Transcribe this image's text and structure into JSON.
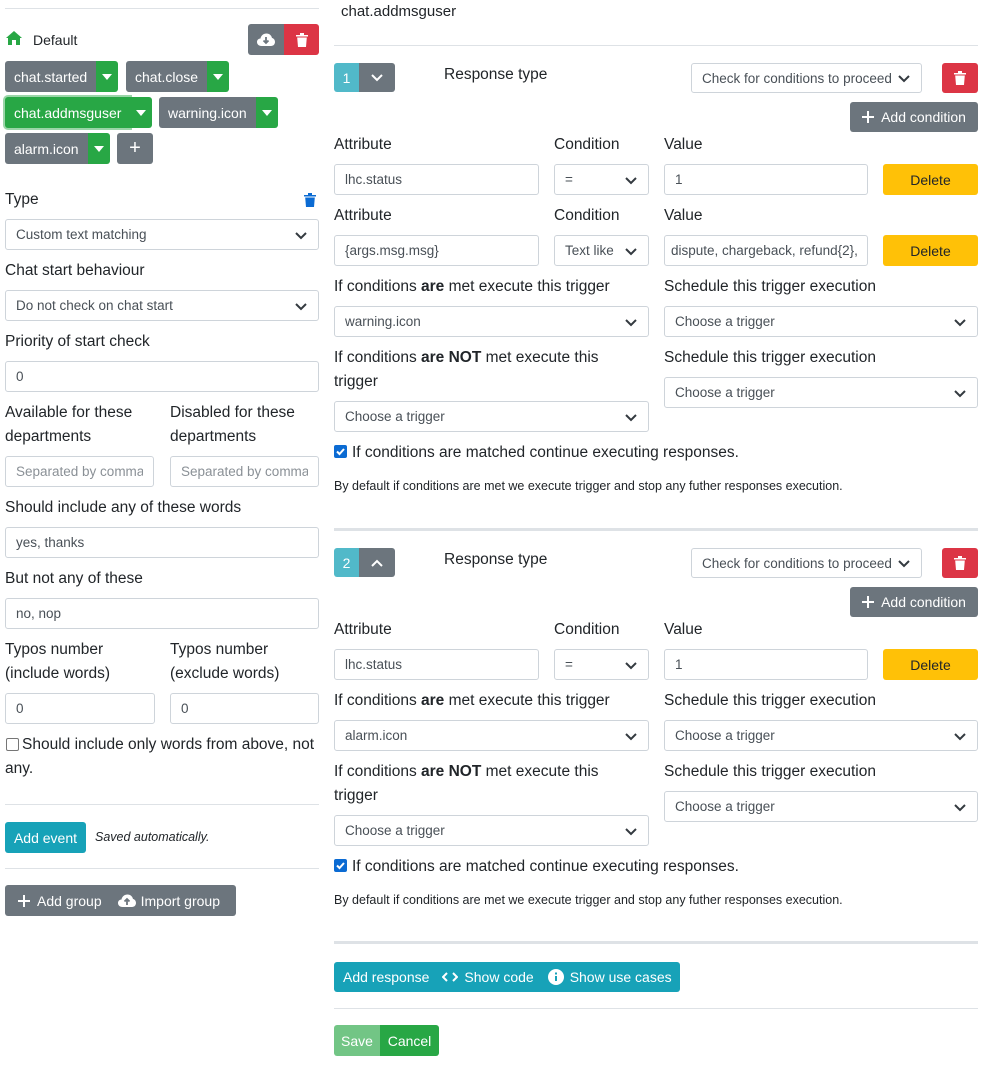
{
  "sidebar": {
    "default_label": "Default",
    "events": [
      "chat.started",
      "chat.close",
      "chat.addmsguser",
      "warning.icon",
      "alarm.icon"
    ],
    "add_event_tag": "+",
    "type_label": "Type",
    "type_value": "Custom text matching",
    "chat_start_label": "Chat start behaviour",
    "chat_start_value": "Do not check on chat start",
    "priority_label": "Priority of start check",
    "priority_value": "0",
    "available_label": "Available for these departments",
    "disabled_label": "Disabled for these departments",
    "available_placeholder": "Separated by commas",
    "disabled_placeholder": "Separated by commas",
    "include_label": "Should include any of these words",
    "include_value": "yes, thanks",
    "exclude_label": "But not any of these",
    "exclude_value": "no, nop",
    "typos_include_label": "Typos number (include words)",
    "typos_exclude_label": "Typos number (exclude words)",
    "typos_include_value": "0",
    "typos_exclude_value": "0",
    "only_words_label": "Should include only words from above, not any.",
    "add_event_button": "Add event",
    "saved_note": "Saved automatically.",
    "add_group_button": "Add group",
    "import_group_button": "Import group"
  },
  "main": {
    "title": "chat.addmsguser",
    "labels": {
      "response_type": "Response type",
      "attribute": "Attribute",
      "condition": "Condition",
      "value": "Value",
      "met_prefix": "If conditions ",
      "met_bold": "are",
      "met_suffix": " met execute this trigger",
      "notmet_bold": "are NOT",
      "notmet_suffix": " met execute this",
      "notmet_line2": "trigger",
      "schedule": "Schedule this trigger execution",
      "continue": "If conditions are matched continue executing responses.",
      "note": "By default if conditions are met we execute trigger and stop any futher responses execution.",
      "add_condition": "Add condition",
      "delete": "Delete"
    },
    "responses": [
      {
        "number": "1",
        "type_value": "Check for conditions to proceed",
        "conditions": [
          {
            "attribute": "lhc.status",
            "condition": "=",
            "value": "1"
          },
          {
            "attribute": "{args.msg.msg}",
            "condition": "Text like",
            "value": "dispute, chargeback, refund{2},"
          }
        ],
        "met_trigger": "warning.icon",
        "met_schedule": "Choose a trigger",
        "notmet_trigger": "Choose a trigger",
        "notmet_schedule": "Choose a trigger"
      },
      {
        "number": "2",
        "type_value": "Check for conditions to proceed",
        "conditions": [
          {
            "attribute": "lhc.status",
            "condition": "=",
            "value": "1"
          }
        ],
        "met_trigger": "alarm.icon",
        "met_schedule": "Choose a trigger",
        "notmet_trigger": "Choose a trigger",
        "notmet_schedule": "Choose a trigger"
      }
    ],
    "toolbar": {
      "add_response": "Add response",
      "show_code": "Show code",
      "show_use_cases": "Show use cases"
    },
    "save": "Save",
    "cancel": "Cancel"
  },
  "colors": {
    "green": "#28a745",
    "gray": "#6c757d",
    "red": "#dc3545",
    "teal": "#17a2b8",
    "yellow": "#ffc107"
  }
}
